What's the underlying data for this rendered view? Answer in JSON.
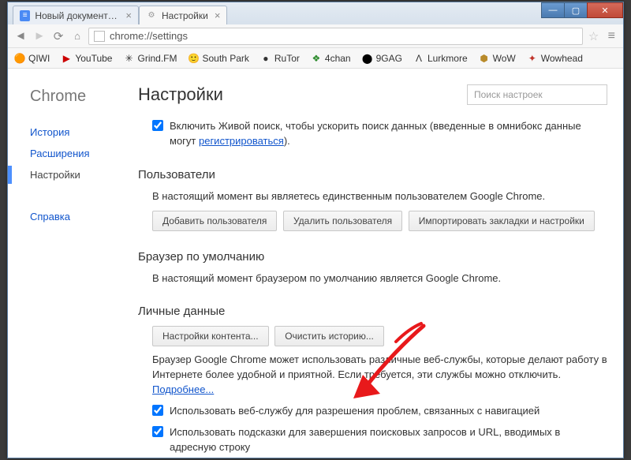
{
  "window": {
    "tabs": [
      {
        "title": "Новый документ - G",
        "favicon": "doc"
      },
      {
        "title": "Настройки",
        "favicon": "gear"
      }
    ],
    "address": "chrome://settings"
  },
  "bookmarks": [
    {
      "label": "QIWI",
      "icon": "🟠",
      "color": "#ff9800"
    },
    {
      "label": "YouTube",
      "icon": "▶",
      "color": "#cc0000"
    },
    {
      "label": "Grind.FM",
      "icon": "✳",
      "color": "#333"
    },
    {
      "label": "South Park",
      "icon": "🙂",
      "color": "#c9a038"
    },
    {
      "label": "RuTor",
      "icon": "●",
      "color": "#333"
    },
    {
      "label": "4chan",
      "icon": "❖",
      "color": "#2a8a2a"
    },
    {
      "label": "9GAG",
      "icon": "⬤",
      "color": "#000"
    },
    {
      "label": "Lurkmore",
      "icon": "Λ",
      "color": "#333"
    },
    {
      "label": "WoW",
      "icon": "⬢",
      "color": "#b88a2a"
    },
    {
      "label": "Wowhead",
      "icon": "✦",
      "color": "#c0332a"
    }
  ],
  "sidebar": {
    "brand": "Chrome",
    "items": [
      {
        "label": "История",
        "active": false
      },
      {
        "label": "Расширения",
        "active": false
      },
      {
        "label": "Настройки",
        "active": true
      },
      {
        "label": "Справка",
        "active": false
      }
    ]
  },
  "page": {
    "title": "Настройки",
    "search_placeholder": "Поиск настроек"
  },
  "live_search": {
    "text_a": "Включить Живой поиск, чтобы ускорить поиск данных (введенные в омнибокс данные могут ",
    "link": "регистрироваться",
    "text_b": ")."
  },
  "users": {
    "heading": "Пользователи",
    "desc": "В настоящий момент вы являетесь единственным пользователем Google Chrome.",
    "btn_add": "Добавить пользователя",
    "btn_del": "Удалить пользователя",
    "btn_import": "Импортировать закладки и настройки"
  },
  "default_browser": {
    "heading": "Браузер по умолчанию",
    "desc": "В настоящий момент браузером по умолчанию является Google Chrome."
  },
  "privacy": {
    "heading": "Личные данные",
    "btn_content": "Настройки контента...",
    "btn_clear": "Очистить историю...",
    "desc_a": "Браузер Google Chrome может использовать различные веб-службы, которые делают работу в Интернете более удобной и приятной. Если требуется, эти службы можно отключить. ",
    "desc_link": "Подробнее...",
    "cb_nav": "Использовать веб-службу для разрешения проблем, связанных с навигацией",
    "cb_suggest": "Использовать подсказки для завершения поисковых запросов и URL, вводимых в адресную строку"
  }
}
